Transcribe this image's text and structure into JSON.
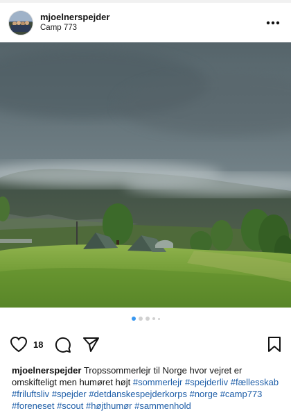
{
  "post": {
    "username": "mjoelnerspejder",
    "location": "Camp 773",
    "likes": "18",
    "caption_user": "mjoelnerspejder",
    "caption_text": "Tropssommerlejr til Norge hvor vejret er omskifteligt men humøret højt",
    "hashtags": [
      "#sommerlejr",
      "#spejderliv",
      "#fællesskab",
      "#friluftsliv",
      "#spejder",
      "#detdanskespejderkorps",
      "#norge",
      "#camp773",
      "#foreneset",
      "#scout",
      "#højthumør",
      "#sammenhold"
    ]
  },
  "carousel": {
    "count": 5,
    "active": 1
  },
  "icons": {
    "more": "more-options-icon",
    "like": "heart-icon",
    "comment": "comment-icon",
    "share": "paper-plane-icon",
    "save": "bookmark-icon"
  },
  "colors": {
    "hashtag": "#1e5ea8",
    "active_dot": "#3897f0"
  }
}
